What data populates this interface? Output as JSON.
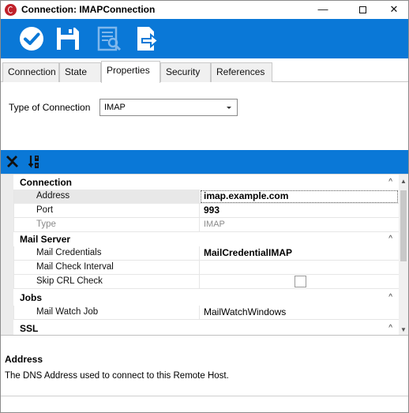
{
  "window": {
    "title": "Connection: IMAPConnection",
    "controls": {
      "minimize": "—",
      "close": "✕"
    }
  },
  "toolbar": {
    "accent_color": "#0a78d7",
    "buttons": [
      {
        "icon": "checkmark-circle-icon"
      },
      {
        "icon": "floppy-disk-icon"
      },
      {
        "icon": "document-preview-icon"
      },
      {
        "icon": "document-export-icon"
      }
    ]
  },
  "tabs": [
    {
      "label": "Connection"
    },
    {
      "label": "State"
    },
    {
      "label": "Properties",
      "active": true
    },
    {
      "label": "Security"
    },
    {
      "label": "References"
    }
  ],
  "type_of_connection": {
    "label": "Type of Connection",
    "value": "IMAP"
  },
  "property_grid": {
    "categories": [
      {
        "name": "Connection",
        "properties": [
          {
            "name": "Address",
            "value": "imap.example.com"
          },
          {
            "name": "Port",
            "value": "993"
          },
          {
            "name": "Type",
            "value": "IMAP"
          }
        ]
      },
      {
        "name": "Mail Server",
        "properties": [
          {
            "name": "Mail Credentials",
            "value": "MailCredentialIMAP"
          },
          {
            "name": "Mail Check Interval",
            "value": ""
          },
          {
            "name": "Skip CRL Check",
            "value": ""
          }
        ]
      },
      {
        "name": "Jobs",
        "properties": [
          {
            "name": "Mail Watch Job",
            "value": "MailWatchWindows"
          }
        ]
      },
      {
        "name": "SSL",
        "properties": []
      }
    ],
    "chevron": "^",
    "scroll_up": "▲",
    "scroll_down": "▼"
  },
  "description": {
    "title": "Address",
    "text": "The DNS Address used to connect to this Remote Host."
  }
}
